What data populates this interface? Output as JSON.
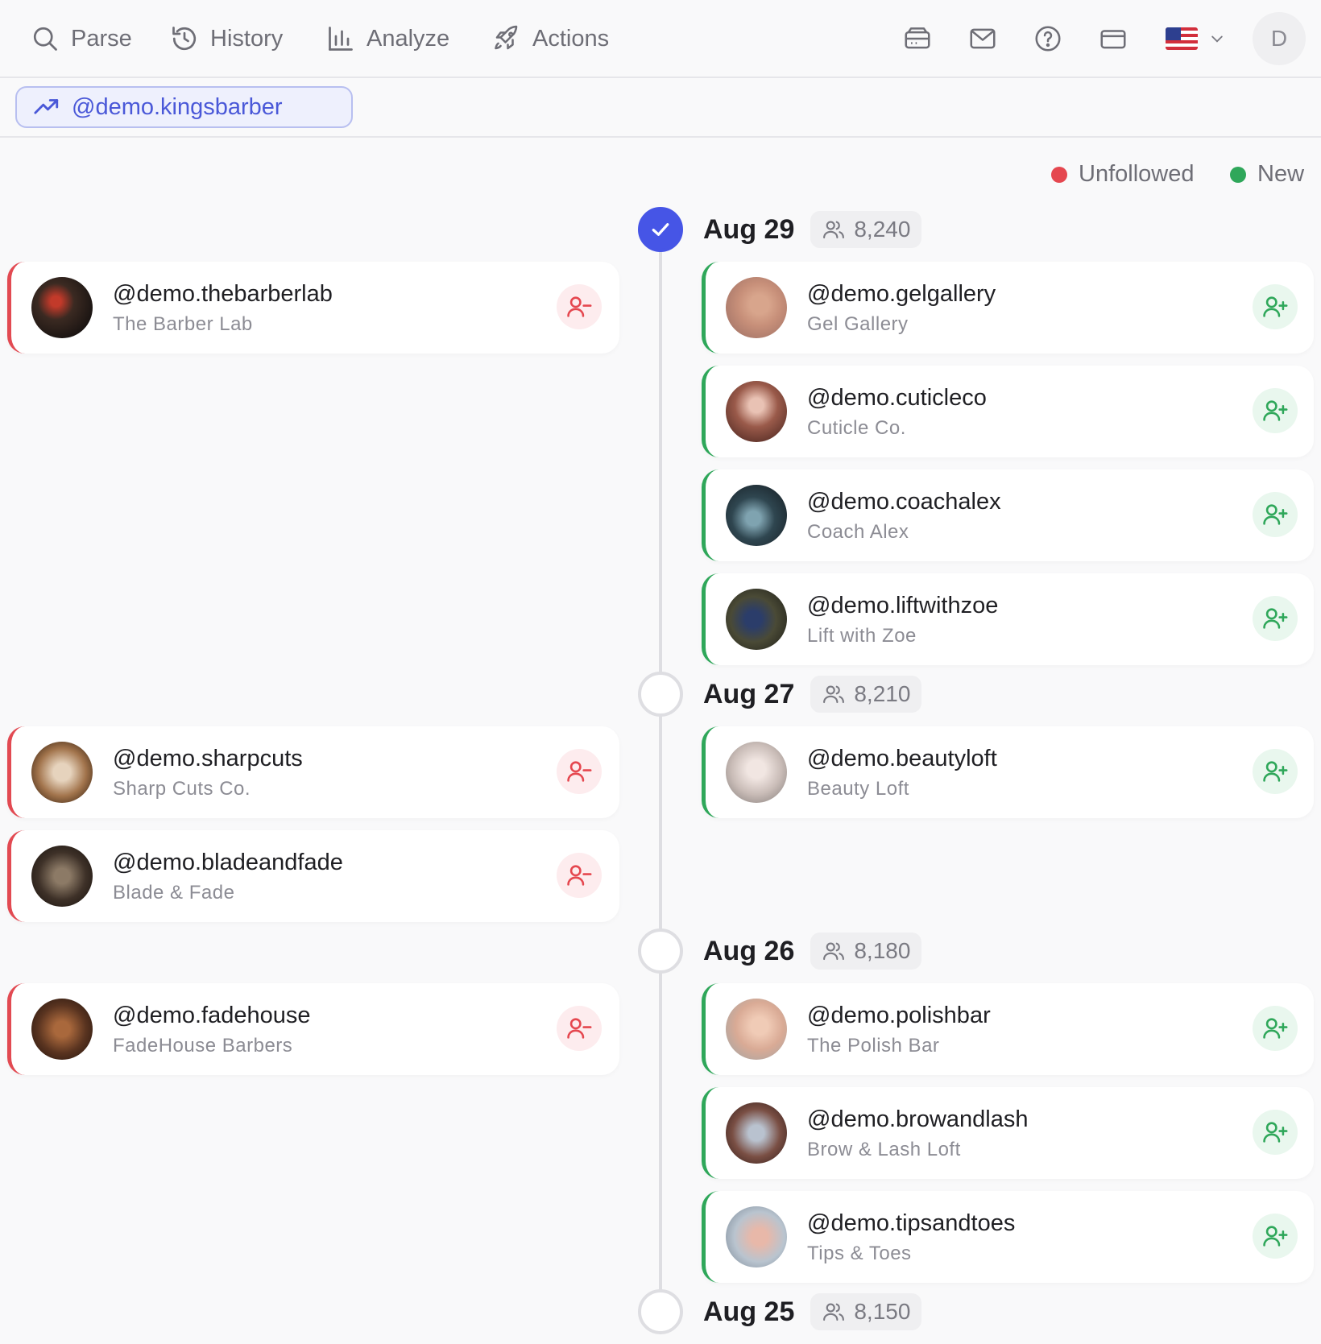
{
  "nav": {
    "items": [
      {
        "label": "Parse",
        "icon": "search-icon"
      },
      {
        "label": "History",
        "icon": "history-icon"
      },
      {
        "label": "Analyze",
        "icon": "bar-chart-icon"
      },
      {
        "label": "Actions",
        "icon": "rocket-icon"
      }
    ],
    "right_icons": [
      "inbox-tray-icon",
      "mail-icon",
      "help-icon",
      "credit-card-icon"
    ],
    "language_flag": "us-flag-icon",
    "user_initial": "D"
  },
  "account_chip": {
    "label": "@demo.kingsbarber",
    "icon": "trending-up-icon"
  },
  "legend": {
    "unfollowed": "Unfollowed",
    "new": "New",
    "unfollowed_color": "#e5474f",
    "new_color": "#2fa75a"
  },
  "timeline": [
    {
      "date": "Aug 29",
      "count": "8,240",
      "active": true,
      "unfollowed": [
        {
          "handle": "@demo.thebarberlab",
          "name": "The Barber Lab"
        }
      ],
      "new": [
        {
          "handle": "@demo.gelgallery",
          "name": "Gel Gallery"
        },
        {
          "handle": "@demo.cuticleco",
          "name": "Cuticle Co."
        },
        {
          "handle": "@demo.coachalex",
          "name": "Coach Alex"
        },
        {
          "handle": "@demo.liftwithzoe",
          "name": "Lift with Zoe"
        }
      ]
    },
    {
      "date": "Aug 27",
      "count": "8,210",
      "active": false,
      "unfollowed": [
        {
          "handle": "@demo.sharpcuts",
          "name": "Sharp Cuts Co."
        },
        {
          "handle": "@demo.bladeandfade",
          "name": "Blade & Fade"
        }
      ],
      "new": [
        {
          "handle": "@demo.beautyloft",
          "name": "Beauty Loft"
        }
      ]
    },
    {
      "date": "Aug 26",
      "count": "8,180",
      "active": false,
      "unfollowed": [
        {
          "handle": "@demo.fadehouse",
          "name": "FadeHouse Barbers"
        }
      ],
      "new": [
        {
          "handle": "@demo.polishbar",
          "name": "The Polish Bar"
        },
        {
          "handle": "@demo.browandlash",
          "name": "Brow & Lash Loft"
        },
        {
          "handle": "@demo.tipsandtoes",
          "name": "Tips & Toes"
        }
      ]
    },
    {
      "date": "Aug 25",
      "count": "8,150",
      "active": false,
      "unfollowed": [],
      "new": []
    }
  ]
}
